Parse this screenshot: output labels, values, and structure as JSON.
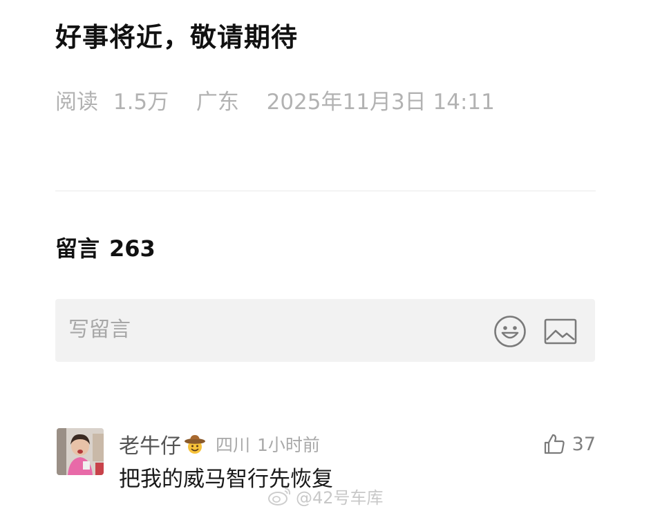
{
  "article": {
    "title": "好事将近，敬请期待",
    "reads_label": "阅读",
    "reads_value": "1.5万",
    "location": "广东",
    "datetime": "2025年11月3日 14:11"
  },
  "comments": {
    "heading": "留言",
    "count": "263",
    "compose_placeholder": "写留言",
    "emoji_icon": "smiley-face-icon",
    "image_icon": "image-picture-icon",
    "items": [
      {
        "user": "老牛仔",
        "badge_icon": "cowboy-emoji-icon",
        "region": "四川",
        "time": "1小时前",
        "likes": "37",
        "text": "把我的威马智行先恢复"
      }
    ]
  },
  "watermark": {
    "text": "@42号车库",
    "icon": "weibo-logo-icon"
  },
  "colors": {
    "meta_gray": "#b2b2b2",
    "input_bg": "#f2f2f2",
    "text_dark": "#191919"
  }
}
